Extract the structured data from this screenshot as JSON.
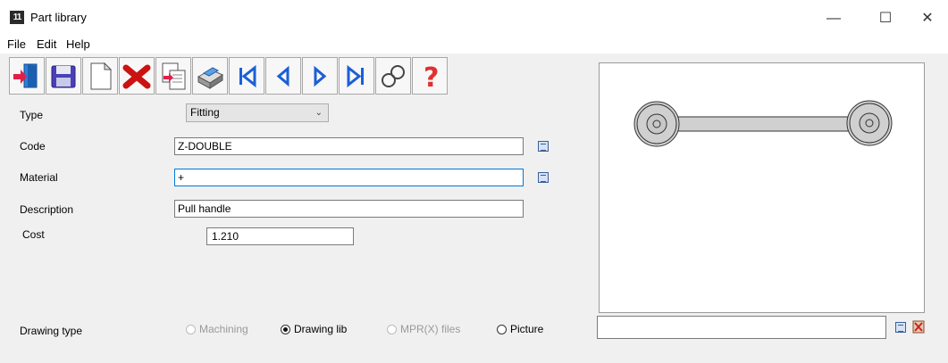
{
  "window": {
    "title": "Part library",
    "icon_text": "11",
    "controls": {
      "minimize": "—",
      "maximize": "☐",
      "close": "✕"
    }
  },
  "menu": {
    "items": [
      "File",
      "Edit",
      "Help"
    ]
  },
  "toolbar": {
    "buttons": [
      "exit-icon",
      "save-icon",
      "new-page-icon",
      "delete-icon",
      "copy-icon",
      "print-icon",
      "first-record-icon",
      "previous-record-icon",
      "next-record-icon",
      "last-record-icon",
      "search-icon",
      "help-icon"
    ]
  },
  "form": {
    "type_label": "Type",
    "type_value": "Fitting",
    "code_label": "Code",
    "code_value": "Z-DOUBLE",
    "material_label": "Material",
    "material_value": "+",
    "description_label": "Description",
    "description_value": "Pull handle",
    "cost_label": "Cost",
    "cost_value": "1.210",
    "drawing_type_label": "Drawing type",
    "drawing_options": [
      {
        "label": "Machining",
        "enabled": false,
        "checked": false
      },
      {
        "label": "Drawing lib",
        "enabled": true,
        "checked": true
      },
      {
        "label": "MPR(X) files",
        "enabled": false,
        "checked": false
      },
      {
        "label": "Picture",
        "enabled": true,
        "checked": false
      }
    ]
  },
  "preview": {
    "path_value": ""
  },
  "colors": {
    "accent_border": "#0078d7",
    "delete_red": "#cc1111",
    "nav_blue": "#1b5fd6"
  }
}
